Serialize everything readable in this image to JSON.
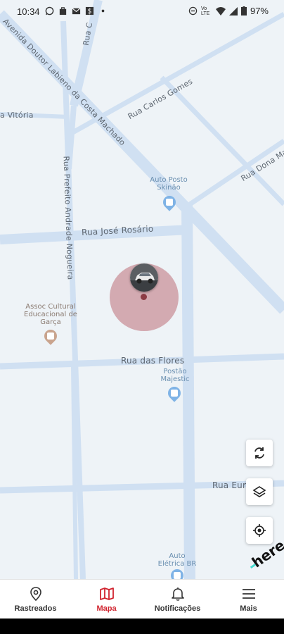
{
  "status_bar": {
    "time": "10:34",
    "battery": "97%",
    "network": "Vo LTE"
  },
  "map": {
    "streets": [
      {
        "id": "avenida",
        "label": "Avenida Doutor Labieno da Costa Machado"
      },
      {
        "id": "rua-c",
        "label": "Rua C"
      },
      {
        "id": "carlos-gomes",
        "label": "Rua Carlos Gomes"
      },
      {
        "id": "vitoria",
        "label": "a Vitória"
      },
      {
        "id": "prefeito",
        "label": "Rua Prefeito Andrade Nogueira"
      },
      {
        "id": "dona-ma",
        "label": "Rua Dona Ma"
      },
      {
        "id": "jose-rosario",
        "label": "Rua José Rosário"
      },
      {
        "id": "flores",
        "label": "Rua das Flores"
      },
      {
        "id": "eum",
        "label": "Rua Eum"
      }
    ],
    "pois": [
      {
        "id": "auto-posto",
        "label": "Auto Posto Skinão",
        "icon": "gas-station-icon"
      },
      {
        "id": "assoc",
        "label": "Assoc Cultural Educacional de Garça",
        "icon": "building-icon"
      },
      {
        "id": "postao",
        "label": "Postão Majestic",
        "icon": "gas-station-icon"
      },
      {
        "id": "auto-eletrica",
        "label": "Auto Elétrica BR",
        "icon": "pin-icon"
      }
    ],
    "vehicle_marker": {
      "icon": "car-icon",
      "accuracy_color": "#be6e78"
    },
    "attribution": "here"
  },
  "map_controls": {
    "refresh_icon": "refresh-icon",
    "layers_icon": "layers-icon",
    "locate_icon": "locate-icon"
  },
  "bottom_nav": {
    "items": [
      {
        "label": "Rastreados",
        "icon": "location-pin-icon",
        "active": false
      },
      {
        "label": "Mapa",
        "icon": "map-icon",
        "active": true
      },
      {
        "label": "Notificações",
        "icon": "bell-icon",
        "active": false
      },
      {
        "label": "Mais",
        "icon": "menu-icon",
        "active": false
      }
    ],
    "active_color": "#d1242f"
  }
}
